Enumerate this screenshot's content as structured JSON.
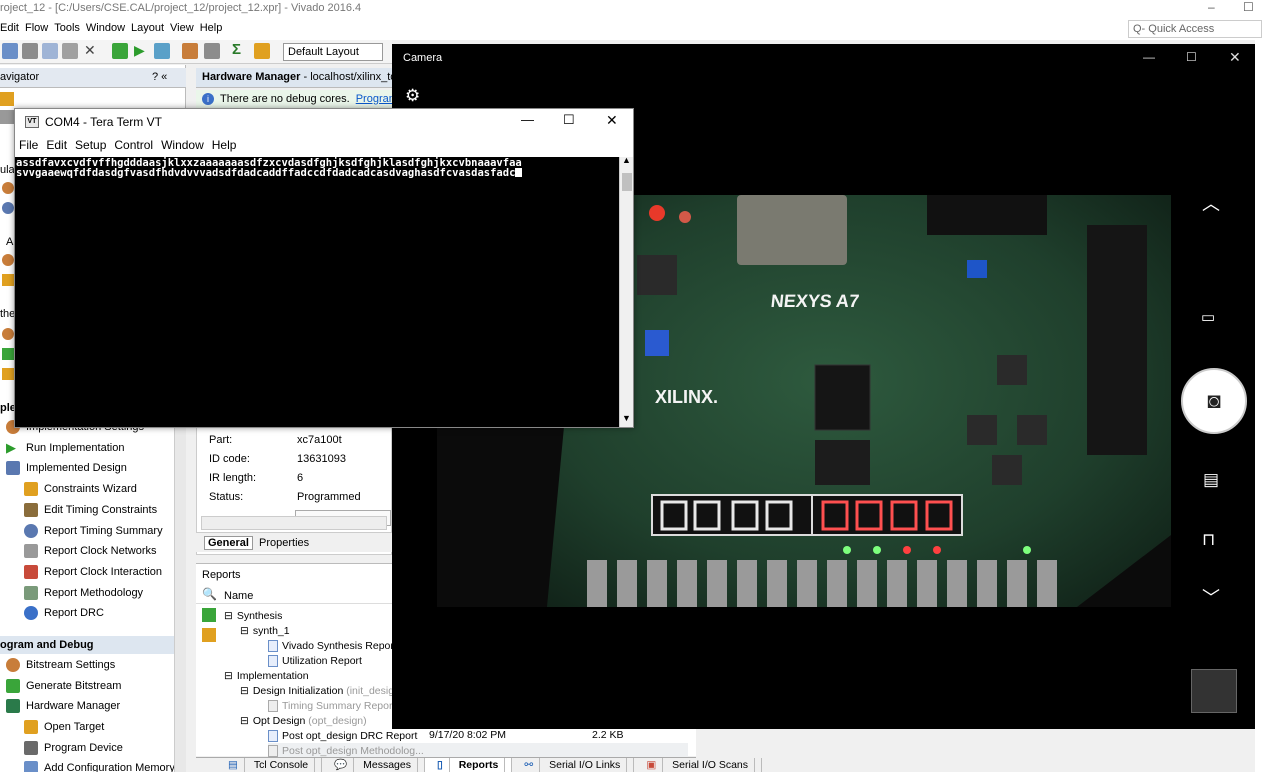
{
  "vivado": {
    "title": "roject_12 - [C:/Users/CSE.CAL/project_12/project_12.xpr] - Vivado 2016.4",
    "menu": [
      "Edit",
      "Flow",
      "Tools",
      "Window",
      "Layout",
      "View",
      "Help"
    ],
    "quick_access_placeholder": "Q- Quick Access",
    "layout_dropdown": "Default Layout"
  },
  "navigator": {
    "title": "avigator",
    "controls": "? «",
    "fragments": [
      "ula",
      "Ar",
      "the",
      "ple"
    ],
    "implementation_items": [
      "Implementation Settings",
      "Run Implementation",
      "Implemented Design"
    ],
    "implemented_design_children": [
      "Constraints Wizard",
      "Edit Timing Constraints",
      "Report Timing Summary",
      "Report Clock Networks",
      "Report Clock Interaction",
      "Report Methodology",
      "Report DRC"
    ],
    "program_debug_section": "ogram and Debug",
    "program_debug_items": [
      "Bitstream Settings",
      "Generate Bitstream",
      "Hardware Manager"
    ],
    "hardware_manager_children": [
      "Open Target",
      "Program Device",
      "Add Configuration Memory"
    ]
  },
  "hardware_manager": {
    "header_title": "Hardware Manager",
    "header_detail": " - localhost/xilinx_tc",
    "banner_text": "There are no debug cores.",
    "banner_link": "Program d",
    "properties": [
      {
        "label": "Part:",
        "value": "xc7a100t"
      },
      {
        "label": "ID code:",
        "value": "13631093"
      },
      {
        "label": "IR length:",
        "value": "6"
      },
      {
        "label": "Status:",
        "value": "Programmed"
      }
    ],
    "tabs": [
      "General",
      "Properties"
    ]
  },
  "reports": {
    "title": "Reports",
    "column_name": "Name",
    "synthesis": "Synthesis",
    "synth_run": "synth_1",
    "synth_reports": [
      "Vivado Synthesis Report",
      "Utilization Report"
    ],
    "implementation": "Implementation",
    "design_init": "Design Initialization",
    "design_init_step": "(init_design",
    "timing_summary": "Timing Summary Report",
    "opt_design": "Opt Design",
    "opt_design_step": "(opt_design)",
    "drc_report": "Post opt_design DRC Report",
    "drc_date": "9/17/20 8:02 PM",
    "drc_size": "2.2 KB",
    "methodology_report": "Post opt_design Methodolog..."
  },
  "bottom_tabs": [
    "Tcl Console",
    "Messages",
    "Reports",
    "Serial I/O Links",
    "Serial I/O Scans"
  ],
  "camera": {
    "title": "Camera",
    "board_label_nexys": "NEXYS A7",
    "board_label_xilinx": "XILINX."
  },
  "teraterm": {
    "title": "COM4 - Tera Term VT",
    "icon_text": "VT",
    "menu": [
      "File",
      "Edit",
      "Setup",
      "Control",
      "Window",
      "Help"
    ],
    "line1": "assdfavxcvdfvffhgdddaasjklxxzaaaaaaasdfzxcvdasdfghjksdfghjklasdfghjkxcvbnaaavfaa",
    "line2": "svvgaaewqfdfdasdgfvasdfhdvdvvvadsdfdadcaddffadccdfdadcadcasdvaghasdfcvasdasfadc"
  }
}
